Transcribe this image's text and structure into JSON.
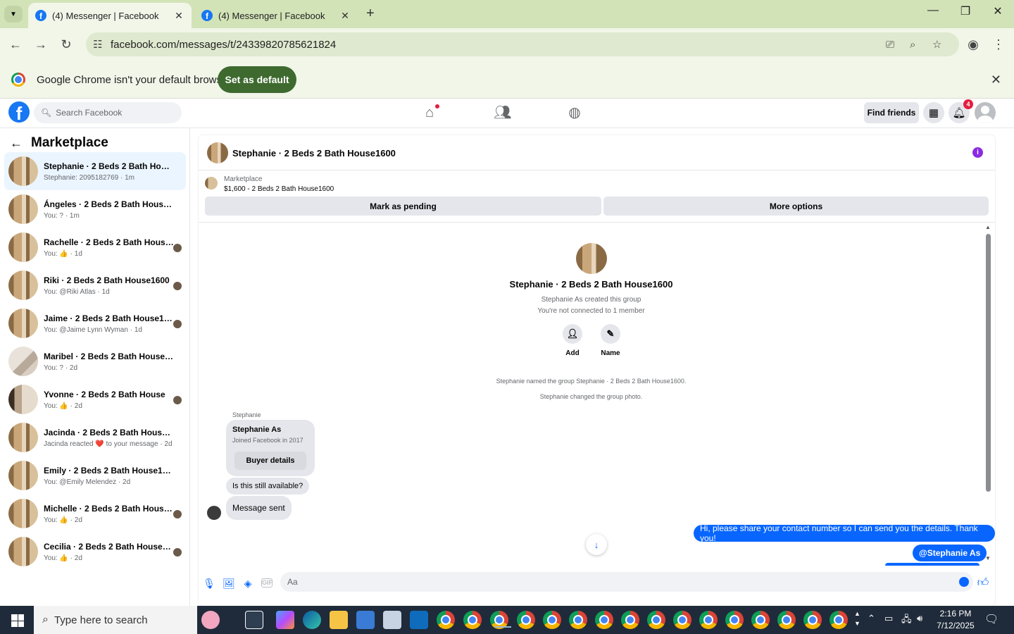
{
  "browser": {
    "tabs": [
      {
        "title": "(4) Messenger | Facebook",
        "active": true
      },
      {
        "title": "(4) Messenger | Facebook",
        "active": false
      }
    ],
    "url": "facebook.com/messages/t/24339820785621824",
    "banner_text": "Google Chrome isn't your default browser",
    "banner_button": "Set as default"
  },
  "fb_header": {
    "search_placeholder": "Search Facebook",
    "find_friends": "Find friends",
    "notification_count": "4"
  },
  "sidebar": {
    "title": "Marketplace",
    "conversations": [
      {
        "name": "Stephanie · 2 Beds 2 Bath House16...",
        "preview": "Stephanie: 2095182769 · 1m",
        "selected": true,
        "thumb": "house",
        "read_avatar": false
      },
      {
        "name": "Ángeles · 2 Beds 2 Bath House1600",
        "preview": "You: ? · 1m",
        "selected": false,
        "thumb": "house",
        "read_avatar": false
      },
      {
        "name": "Rachelle · 2 Beds 2 Bath House1...",
        "preview": "You: 👍 · 1d",
        "selected": false,
        "thumb": "house",
        "read_avatar": true
      },
      {
        "name": "Riki · 2 Beds 2 Bath House1600",
        "preview": "You: @Riki Atlas · 1d",
        "selected": false,
        "thumb": "house",
        "read_avatar": true
      },
      {
        "name": "Jaime · 2 Beds 2 Bath House1600",
        "preview": "You: @Jaime Lynn Wyman · 1d",
        "selected": false,
        "thumb": "house",
        "read_avatar": true
      },
      {
        "name": "Maribel · 2 Beds 2 Bath House1600",
        "preview": "You: ? · 2d",
        "selected": false,
        "thumb": "room",
        "read_avatar": false
      },
      {
        "name": "Yvonne · 2 Beds 2 Bath House",
        "preview": "You: 👍 · 2d",
        "selected": false,
        "thumb": "door",
        "read_avatar": true
      },
      {
        "name": "Jacinda · 2 Beds 2 Bath House1600",
        "preview": "Jacinda reacted ❤️ to your message · 2d",
        "selected": false,
        "thumb": "house",
        "read_avatar": false
      },
      {
        "name": "Emily · 2 Beds 2 Bath House1600",
        "preview": "You: @Emily Melendez · 2d",
        "selected": false,
        "thumb": "house",
        "read_avatar": false
      },
      {
        "name": "Michelle · 2 Beds 2 Bath House1...",
        "preview": "You: 👍 · 2d",
        "selected": false,
        "thumb": "house",
        "read_avatar": true
      },
      {
        "name": "Cecilia · 2 Beds 2 Bath House1600",
        "preview": "You: 👍 · 2d",
        "selected": false,
        "thumb": "house",
        "read_avatar": true
      }
    ]
  },
  "chat": {
    "title": "Stephanie · 2 Beds 2 Bath House1600",
    "marketplace_label": "Marketplace",
    "listing": "$1,600 - 2 Beds 2 Bath House1600",
    "mark_pending": "Mark as pending",
    "more_options": "More options",
    "group_title": "Stephanie · 2 Beds 2 Bath House1600",
    "created_by": "Stephanie As created this group",
    "not_connected": "You're not connected to 1 member",
    "add_label": "Add",
    "name_label": "Name",
    "sys_named": "Stephanie named the group Stephanie · 2 Beds 2 Bath House1600.",
    "sys_photo": "Stephanie changed the group photo.",
    "sender": "Stephanie",
    "card_name": "Stephanie As",
    "card_joined": "Joined Facebook in 2017",
    "card_button": "Buyer details",
    "msg_in_1": "Is this still available?",
    "msg_in_2": "Message sent",
    "msg_out_1": "Hi, please share your contact number so I can send you the details. Thank you!",
    "msg_out_2": "@Stephanie As",
    "input_placeholder": "Aa",
    "gif_label": "GIF"
  },
  "taskbar": {
    "search_placeholder": "Type here to search",
    "time": "2:16 PM",
    "date": "7/12/2025"
  },
  "colors": {
    "fb_blue": "#1877f2",
    "messenger_blue": "#0866ff",
    "chrome_green": "#3e6a2f"
  }
}
